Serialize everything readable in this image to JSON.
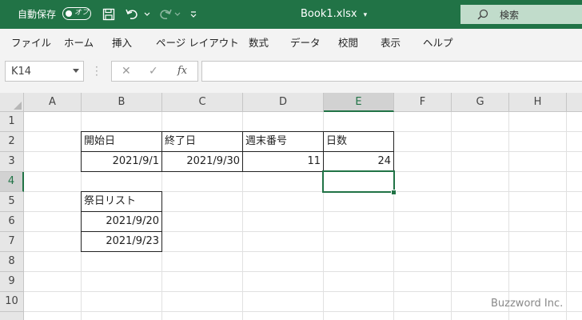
{
  "titlebar": {
    "autosave_label": "自動保存",
    "autosave_state": "オフ",
    "window_title": "Book1.xlsx",
    "search_placeholder": "検索",
    "bg_color": "#217346"
  },
  "menu": [
    "ファイル",
    "ホーム",
    "挿入",
    "ページ レイアウト",
    "数式",
    "データ",
    "校閲",
    "表示",
    "ヘルプ"
  ],
  "formula_bar": {
    "name_box": "K14",
    "fx_label": "fx",
    "formula": ""
  },
  "grid": {
    "columns": [
      "A",
      "B",
      "C",
      "D",
      "E",
      "F",
      "G",
      "H"
    ],
    "rows": [
      "1",
      "2",
      "3",
      "4",
      "5",
      "6",
      "7",
      "8",
      "9",
      "10"
    ],
    "selected_column": "E",
    "selected_row": "4",
    "cells": {
      "B2": "開始日",
      "C2": "終了日",
      "D2": "週末番号",
      "E2": "日数",
      "B3": "2021/9/1",
      "C3": "2021/9/30",
      "D3": "11",
      "E3": "24",
      "B5": "祭日リスト",
      "B6": "2021/9/20",
      "B7": "2021/9/23"
    }
  },
  "watermark": "Buzzword Inc."
}
